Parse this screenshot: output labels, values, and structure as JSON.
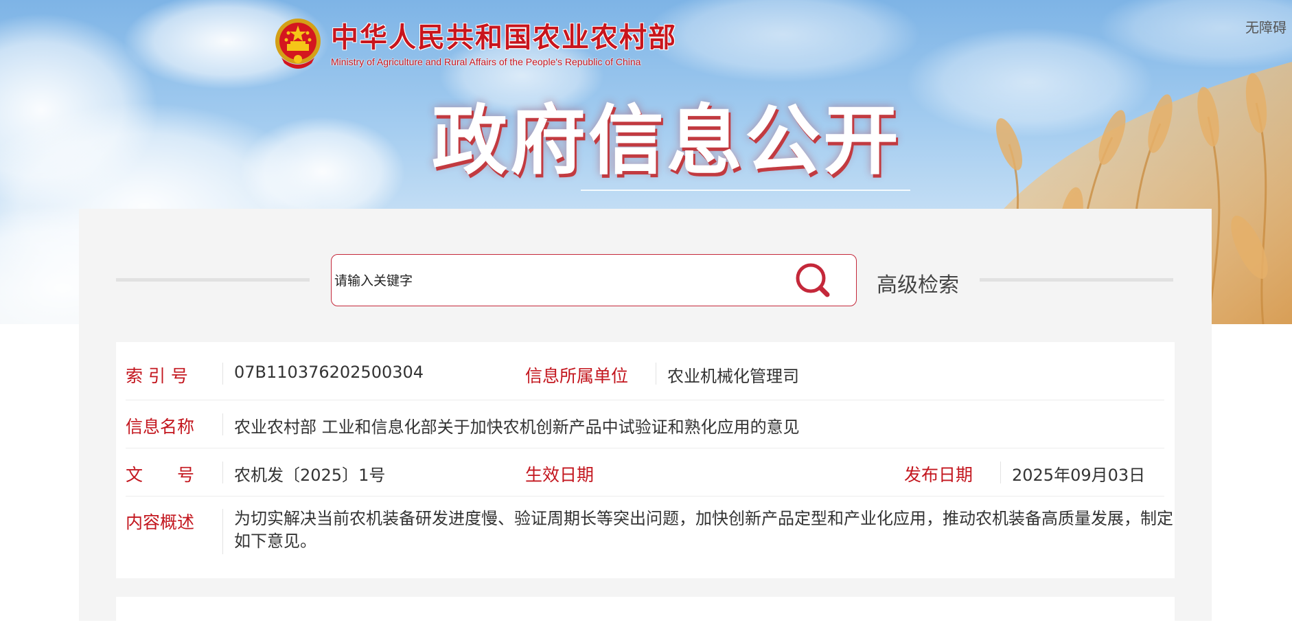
{
  "header": {
    "accessibility": "无障碍",
    "logo_cn": "中华人民共和国农业农村部",
    "logo_en": "Ministry of Agriculture  and  Rural  Affairs  of  the People's Republic of China",
    "banner_title": "政府信息公开"
  },
  "search": {
    "placeholder": "请输入关键字",
    "advanced_label": "高级检索"
  },
  "info": {
    "index_label": "索 引 号",
    "index_value": "07B110376202500304",
    "unit_label": "信息所属单位",
    "unit_value": "农业机械化管理司",
    "name_label": "信息名称",
    "name_value": "农业农村部 工业和信息化部关于加快农机创新产品中试验证和熟化应用的意见",
    "docno_label": "文　　号",
    "docno_value": "农机发〔2025〕1号",
    "effective_label": "生效日期",
    "effective_value": "",
    "publish_label": "发布日期",
    "publish_value": "2025年09月03日",
    "summary_label": "内容概述",
    "summary_value": "为切实解决当前农机装备研发进度慢、验证周期长等突出问题，加快创新产品定型和产业化应用，推动农机装备高质量发展，制定如下意见。"
  },
  "colors": {
    "accent_red": "#c3161e",
    "search_border": "#c4283a"
  },
  "icons": {
    "emblem": "national-emblem-icon",
    "search": "search-icon"
  }
}
